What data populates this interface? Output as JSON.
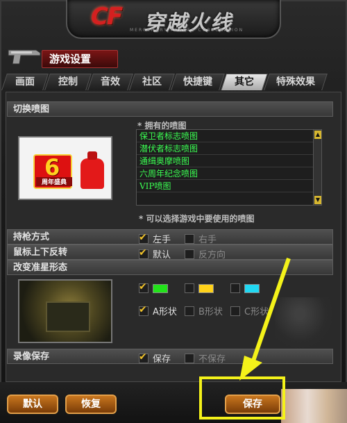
{
  "logo": {
    "text": "CF",
    "title": "穿越火线",
    "subtitle": "MERCENARY FORCES CORPORATION"
  },
  "window": {
    "title": "游戏设置"
  },
  "tabs": [
    "画面",
    "控制",
    "音效",
    "社区",
    "快捷键",
    "其它",
    "特殊效果"
  ],
  "active_tab": "其它",
  "spray": {
    "section_title": "切换喷图",
    "preview_badge_num": "6",
    "preview_badge_text": "周年盛典",
    "owned_label": "* 拥有的喷图",
    "items": [
      "保卫者标志喷图",
      "潜伏者标志喷图",
      "通缉奥摩喷图",
      "六周年纪念喷图",
      "VIP喷图"
    ],
    "hint": "* 可以选择游戏中要使用的喷图"
  },
  "grip": {
    "label": "持枪方式",
    "opt1": "左手",
    "opt2": "右手"
  },
  "invert": {
    "label": "鼠标上下反转",
    "opt1": "默认",
    "opt2": "反方向"
  },
  "crosshair": {
    "section_title": "改变准星形态",
    "colors": [
      "#22e31a",
      "#ffd21a",
      "#21d8f2"
    ],
    "shape_a": "A形状",
    "shape_b": "B形状",
    "shape_c": "C形状"
  },
  "record": {
    "label": "录像保存",
    "opt1": "保存",
    "opt2": "不保存"
  },
  "buttons": {
    "default": "默认",
    "restore": "恢复",
    "save": "保存"
  }
}
